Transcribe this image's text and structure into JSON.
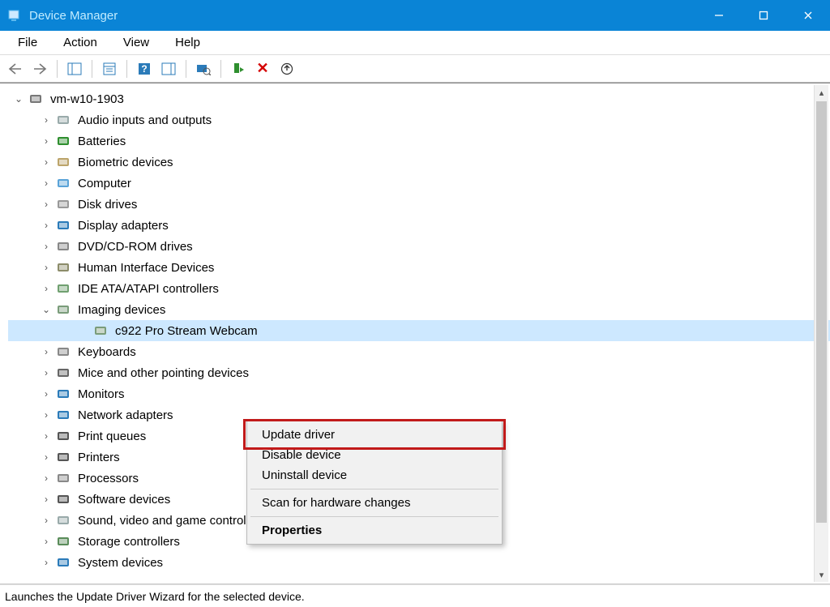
{
  "window": {
    "title": "Device Manager"
  },
  "menubar": {
    "items": [
      "File",
      "Action",
      "View",
      "Help"
    ]
  },
  "tree": {
    "root": "vm-w10-1903",
    "nodes": [
      {
        "label": "Audio inputs and outputs",
        "expanded": false
      },
      {
        "label": "Batteries",
        "expanded": false
      },
      {
        "label": "Biometric devices",
        "expanded": false
      },
      {
        "label": "Computer",
        "expanded": false
      },
      {
        "label": "Disk drives",
        "expanded": false
      },
      {
        "label": "Display adapters",
        "expanded": false
      },
      {
        "label": "DVD/CD-ROM drives",
        "expanded": false
      },
      {
        "label": "Human Interface Devices",
        "expanded": false
      },
      {
        "label": "IDE ATA/ATAPI controllers",
        "expanded": false
      },
      {
        "label": "Imaging devices",
        "expanded": true,
        "children": [
          {
            "label": "c922 Pro Stream Webcam",
            "selected": true
          }
        ]
      },
      {
        "label": "Keyboards",
        "expanded": false
      },
      {
        "label": "Mice and other pointing devices",
        "expanded": false
      },
      {
        "label": "Monitors",
        "expanded": false
      },
      {
        "label": "Network adapters",
        "expanded": false
      },
      {
        "label": "Print queues",
        "expanded": false
      },
      {
        "label": "Printers",
        "expanded": false
      },
      {
        "label": "Processors",
        "expanded": false
      },
      {
        "label": "Software devices",
        "expanded": false
      },
      {
        "label": "Sound, video and game controllers",
        "expanded": false
      },
      {
        "label": "Storage controllers",
        "expanded": false
      },
      {
        "label": "System devices",
        "expanded": false
      }
    ]
  },
  "context_menu": {
    "items": [
      {
        "label": "Update driver",
        "highlighted": true
      },
      {
        "label": "Disable device"
      },
      {
        "label": "Uninstall device"
      },
      {
        "separator": true
      },
      {
        "label": "Scan for hardware changes"
      },
      {
        "separator": true
      },
      {
        "label": "Properties",
        "bold": true
      }
    ]
  },
  "statusbar": {
    "text": "Launches the Update Driver Wizard for the selected device."
  },
  "icons": {
    "root": "computer-icon",
    "categories": [
      "speaker-icon",
      "battery-icon",
      "fingerprint-icon",
      "monitor-tower-icon",
      "harddrive-icon",
      "display-icon",
      "cdrom-icon",
      "hid-icon",
      "ide-icon",
      "camera-icon",
      "keyboard-icon",
      "mouse-icon",
      "monitor-icon",
      "network-icon",
      "printqueue-icon",
      "printer-icon",
      "cpu-icon",
      "software-icon",
      "sound-icon",
      "storage-icon",
      "system-icon"
    ]
  }
}
